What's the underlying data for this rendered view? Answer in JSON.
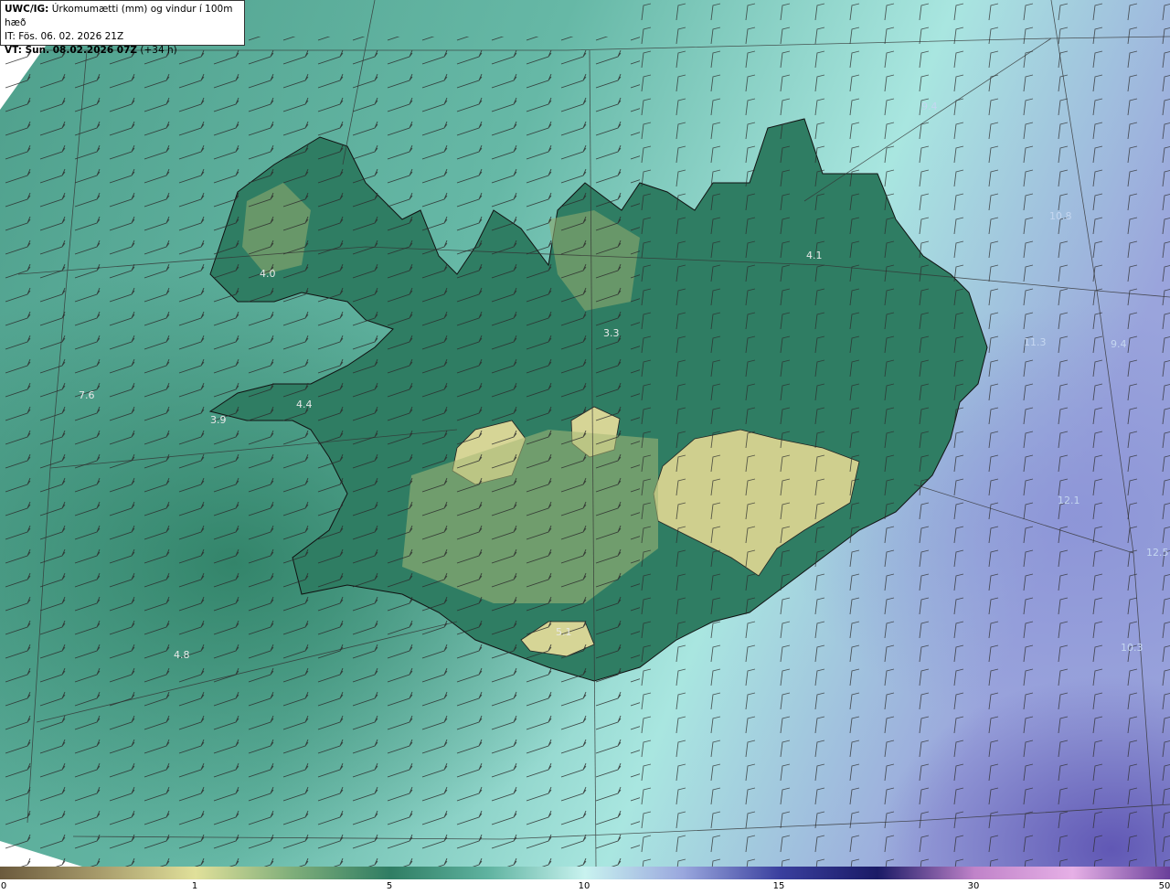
{
  "header": {
    "line1_bold": "UWC/IG:",
    "line1_text": " Úrkomumætti (mm) og vindur í 100m hæð",
    "line2": "IT: Fös. 06. 02. 2026 21Z",
    "line3_bold": "VT: Sun. 08.02.2026 07Z",
    "line3_text": " (+34 h)"
  },
  "map_values": [
    {
      "id": "westfjords",
      "text": "4.0"
    },
    {
      "id": "north",
      "text": "3.3"
    },
    {
      "id": "northeast",
      "text": "4.1"
    },
    {
      "id": "west-sea",
      "text": "7.6"
    },
    {
      "id": "snaefellsnes",
      "text": "4.4"
    },
    {
      "id": "snaefellsnes-tip",
      "text": "3.9"
    },
    {
      "id": "southwest-sea",
      "text": "4.8"
    },
    {
      "id": "east-sea-1",
      "text": "11.3"
    },
    {
      "id": "east-sea-2",
      "text": "9.4"
    },
    {
      "id": "southeast-sea",
      "text": "12.1"
    },
    {
      "id": "east-edge",
      "text": "12.5"
    },
    {
      "id": "south-glacier",
      "text": "5.1"
    },
    {
      "id": "far-southeast",
      "text": "10.3"
    },
    {
      "id": "northeast-sea",
      "text": "10.8"
    },
    {
      "id": "north-sea",
      "text": "9.4"
    }
  ],
  "colorbar": {
    "ticks": [
      {
        "label": "0",
        "value": 0
      },
      {
        "label": "1",
        "value": 1
      },
      {
        "label": "5",
        "value": 5
      },
      {
        "label": "10",
        "value": 10
      },
      {
        "label": "15",
        "value": 15
      },
      {
        "label": "30",
        "value": 30
      },
      {
        "label": "50",
        "value": 50
      }
    ],
    "colors": [
      "#6b5a3d",
      "#a69a6a",
      "#e0e09a",
      "#7fae7a",
      "#2f7d63",
      "#5fb3a0",
      "#c8f2ef",
      "#9aa8de",
      "#3a3f9e",
      "#1a1a66",
      "#c083c9",
      "#e6b0e6",
      "#6a3f9a"
    ]
  },
  "colors": {
    "sea_light": "#a8e0d8",
    "sea_mid": "#6ebfae",
    "land_low": "#2f7d63",
    "land_high": "#d8d895",
    "wind_barb": "#333333",
    "coast": "#111111"
  }
}
